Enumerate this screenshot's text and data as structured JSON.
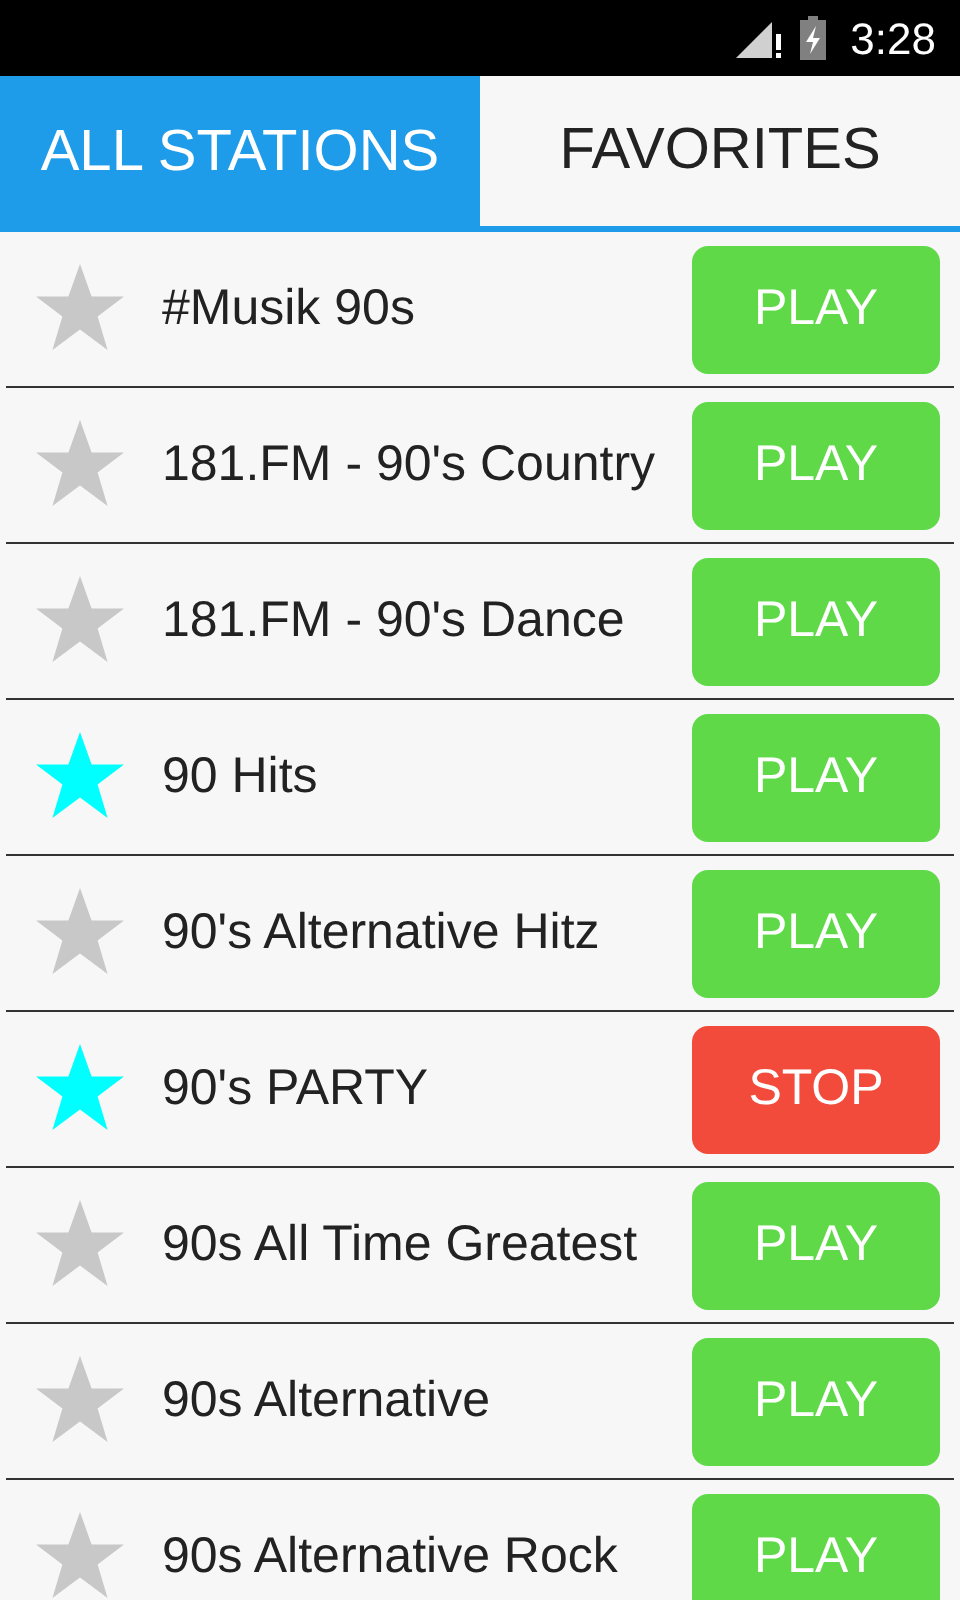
{
  "status_bar": {
    "time": "3:28"
  },
  "tabs": [
    {
      "label": "ALL STATIONS",
      "selected": true
    },
    {
      "label": "FAVORITES",
      "selected": false
    }
  ],
  "stations": [
    {
      "name": "#Musik 90s",
      "favorite": false,
      "playing": false,
      "button": "PLAY"
    },
    {
      "name": "181.FM - 90's Country",
      "favorite": false,
      "playing": false,
      "button": "PLAY"
    },
    {
      "name": "181.FM - 90's Dance",
      "favorite": false,
      "playing": false,
      "button": "PLAY"
    },
    {
      "name": "90 Hits",
      "favorite": true,
      "playing": false,
      "button": "PLAY"
    },
    {
      "name": "90's Alternative Hitz",
      "favorite": false,
      "playing": false,
      "button": "PLAY"
    },
    {
      "name": "90's PARTY",
      "favorite": true,
      "playing": true,
      "button": "STOP"
    },
    {
      "name": "90s All Time Greatest",
      "favorite": false,
      "playing": false,
      "button": "PLAY"
    },
    {
      "name": "90s Alternative",
      "favorite": false,
      "playing": false,
      "button": "PLAY"
    },
    {
      "name": "90s Alternative Rock",
      "favorite": false,
      "playing": false,
      "button": "PLAY"
    }
  ]
}
